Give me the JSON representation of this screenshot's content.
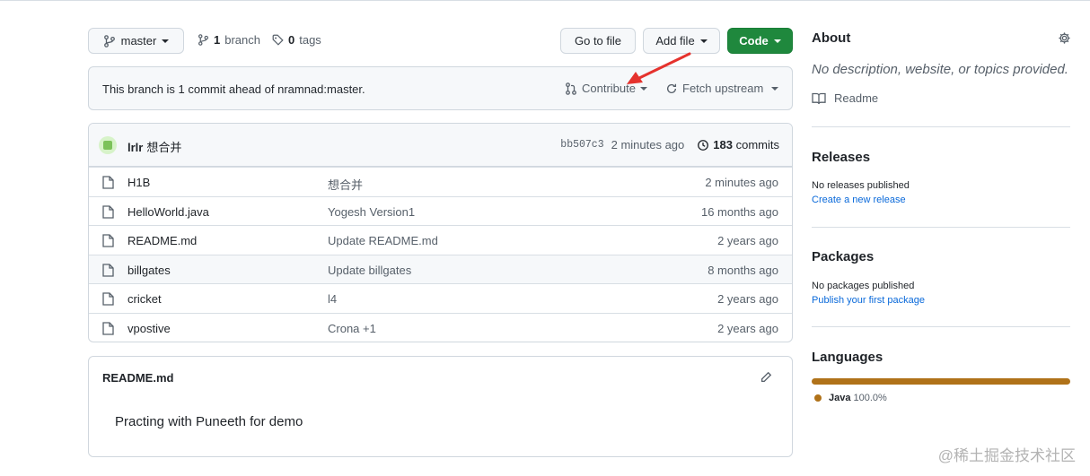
{
  "branch": {
    "current": "master",
    "branch_count": "1",
    "branch_label": "branch",
    "tag_count": "0",
    "tag_label": "tags"
  },
  "toolbar": {
    "go_to_file": "Go to file",
    "add_file": "Add file",
    "code": "Code"
  },
  "ahead": {
    "message": "This branch is 1 commit ahead of nramnad:master.",
    "contribute": "Contribute",
    "fetch_upstream": "Fetch upstream"
  },
  "latest_commit": {
    "author": "lrlr",
    "message": "想合并",
    "sha": "bb507c3",
    "time": "2 minutes ago",
    "commit_count": "183",
    "commit_label": "commits"
  },
  "files": [
    {
      "name": "H1B",
      "message": "想合并",
      "age": "2 minutes ago"
    },
    {
      "name": "HelloWorld.java",
      "message": "Yogesh Version1",
      "age": "16 months ago"
    },
    {
      "name": "README.md",
      "message": "Update README.md",
      "age": "2 years ago"
    },
    {
      "name": "billgates",
      "message": "Update billgates",
      "age": "8 months ago"
    },
    {
      "name": "cricket",
      "message": "l4",
      "age": "2 years ago"
    },
    {
      "name": "vpostive",
      "message": "Crona +1",
      "age": "2 years ago"
    }
  ],
  "readme": {
    "title": "README.md",
    "body": "Practing with Puneeth for demo"
  },
  "sidebar": {
    "about_title": "About",
    "description": "No description, website, or topics provided.",
    "readme_link": "Readme",
    "releases_title": "Releases",
    "releases_text": "No releases published",
    "releases_link": "Create a new release",
    "packages_title": "Packages",
    "packages_text": "No packages published",
    "packages_link": "Publish your first package",
    "languages_title": "Languages",
    "language_name": "Java",
    "language_percent": "100.0%",
    "language_color": "#b07219"
  },
  "watermark": "@稀土掘金技术社区",
  "colors": {
    "primary_green": "#1f883d",
    "annotation_red": "#e5322d",
    "link_blue": "#0969da"
  }
}
